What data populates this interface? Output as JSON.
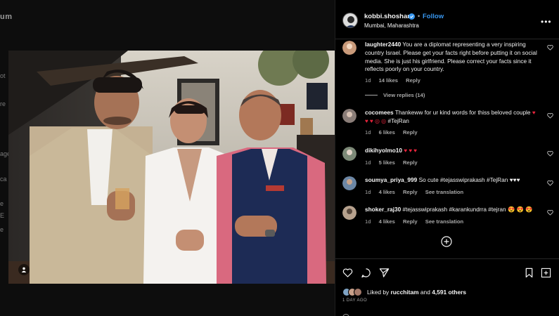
{
  "background": {
    "logo_fragment": "um",
    "side_fragments": [
      "ot",
      "re",
      "age",
      "ca",
      "e",
      "E",
      "e"
    ]
  },
  "post": {
    "image_alt": "Three people posing together at an indoor party",
    "user_tag_icon": "person-icon"
  },
  "header": {
    "username": "kobbi.shoshani",
    "verified_icon": "verified-badge-icon",
    "separator": "•",
    "follow_label": "Follow",
    "location": "Mumbai, Maharashtra",
    "more_icon": "more-options-icon"
  },
  "comments": [
    {
      "username": "laughter2440",
      "text": "You are a diplomat representing a very inspiring country Israel. Please get your facts right before putting it on social media. She is just his girlfriend. Please correct your facts since it reflects poorly on your country.",
      "age": "1d",
      "likes": "14 likes",
      "reply": "Reply",
      "avatar_color": "#c99a7a"
    },
    {
      "username": "cocomees",
      "text": "Thankeww for ur kind words for thiss beloved couple",
      "emoji": "♥ ♥ ♥ ◎ ◎",
      "tail": "#TejRan",
      "age": "1d",
      "likes": "6 likes",
      "reply": "Reply",
      "avatar_color": "#8a7d78"
    },
    {
      "username": "dikihyolmo10",
      "text": "",
      "emoji": "♥ ♥ ♥",
      "age": "1d",
      "likes": "5 likes",
      "reply": "Reply",
      "avatar_color": "#7d8a78"
    },
    {
      "username": "soumya_priya_999",
      "text": "So cute #tejasswiprakash #TejRan",
      "emoji_white": "♥♥♥",
      "age": "1d",
      "likes": "4 likes",
      "reply": "Reply",
      "translate": "See translation",
      "avatar_color": "#6c87a5"
    },
    {
      "username": "shoker_raj30",
      "text": "#tejasswiprakash #karankundrra #tejran",
      "emoji": "😍 😍 😍",
      "age": "1d",
      "likes": "4 likes",
      "reply": "Reply",
      "translate": "See translation",
      "avatar_color": "#b7a28e"
    }
  ],
  "view_replies": "View replies (14)",
  "actions": {
    "like_icon": "heart-icon",
    "comment_icon": "comment-icon",
    "share_icon": "send-icon",
    "save_icon": "bookmark-icon",
    "likes_prefix": "Liked by",
    "likes_user": "rucchitam",
    "likes_joiner": "and",
    "likes_others": "4,591 others",
    "timestamp": "1 DAY AGO"
  },
  "colors": {
    "follow": "#3897f0",
    "emoji_heart": "#e8243c",
    "panel_bg": "#000000"
  }
}
